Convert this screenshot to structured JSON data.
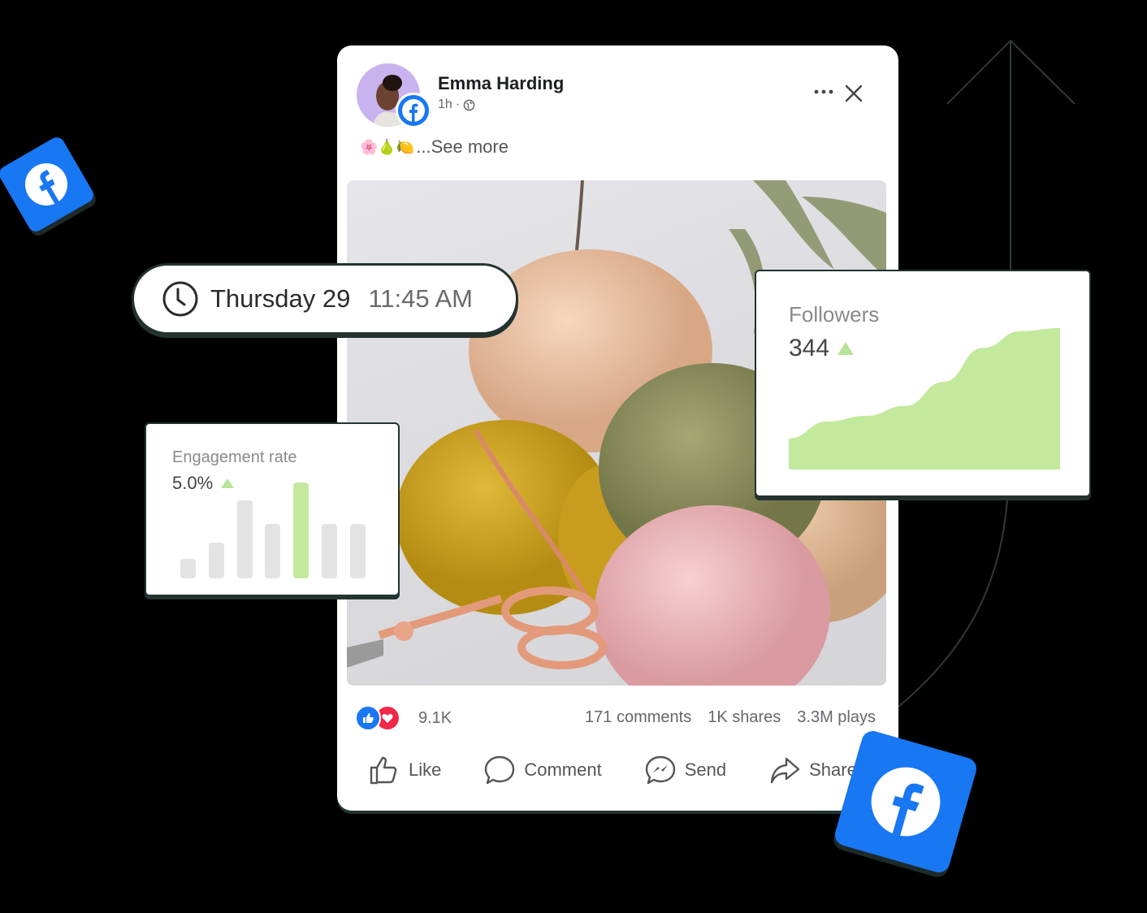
{
  "post": {
    "author": "Emma Harding",
    "time": "1h",
    "separator": "·",
    "privacy_icon": "globe-icon",
    "caption_emojis": "🌸🍐🍋",
    "see_more": "...See more",
    "more_icon": "more-horizontal-icon",
    "close_icon": "close-icon",
    "photo_description": "Balls of yarn (peach, yellow, green, pink) with crochet hook and rose-gold scissors"
  },
  "stats": {
    "reactions": [
      "like",
      "love"
    ],
    "reaction_count": "9.1K",
    "comments": "171 comments",
    "shares": "1K shares",
    "plays": "3.3M plays"
  },
  "actions": [
    {
      "label": "Like",
      "icon": "thumbs-up-icon"
    },
    {
      "label": "Comment",
      "icon": "comment-icon"
    },
    {
      "label": "Send",
      "icon": "messenger-icon"
    },
    {
      "label": "Share",
      "icon": "share-icon"
    }
  ],
  "schedule": {
    "icon": "clock-icon",
    "day": "Thursday 29",
    "time": "11:45 AM"
  },
  "engagement": {
    "label": "Engagement rate",
    "value": "5.0%",
    "trend": "up",
    "bars": [
      0.2,
      0.37,
      0.81,
      0.57,
      1.0,
      0.57,
      0.57
    ],
    "highlight_index": 4
  },
  "followers": {
    "label": "Followers",
    "value": "344",
    "trend": "up",
    "curve": [
      0.22,
      0.34,
      0.38,
      0.45,
      0.62,
      0.86,
      0.98,
      1.0
    ]
  },
  "colors": {
    "background": "#000000",
    "facebook_blue": "#1877f2",
    "accent_green": "#c3e99c",
    "bar_gray": "#e3e3e3",
    "card_border": "#233330",
    "love_red": "#f0284a"
  }
}
